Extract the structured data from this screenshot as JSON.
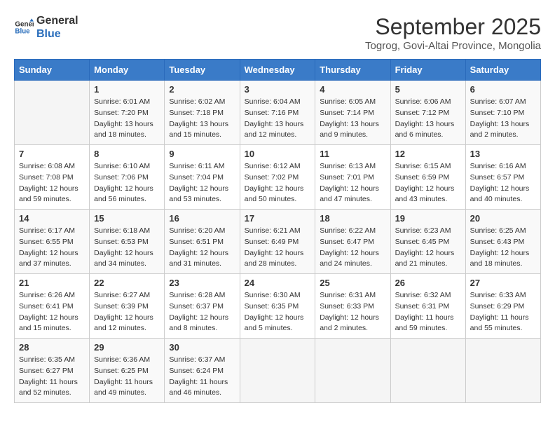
{
  "logo": {
    "line1": "General",
    "line2": "Blue"
  },
  "title": {
    "month_year": "September 2025",
    "location": "Togrog, Govi-Altai Province, Mongolia"
  },
  "calendar": {
    "days_of_week": [
      "Sunday",
      "Monday",
      "Tuesday",
      "Wednesday",
      "Thursday",
      "Friday",
      "Saturday"
    ],
    "weeks": [
      [
        {
          "day": "",
          "info": ""
        },
        {
          "day": "1",
          "info": "Sunrise: 6:01 AM\nSunset: 7:20 PM\nDaylight: 13 hours\nand 18 minutes."
        },
        {
          "day": "2",
          "info": "Sunrise: 6:02 AM\nSunset: 7:18 PM\nDaylight: 13 hours\nand 15 minutes."
        },
        {
          "day": "3",
          "info": "Sunrise: 6:04 AM\nSunset: 7:16 PM\nDaylight: 13 hours\nand 12 minutes."
        },
        {
          "day": "4",
          "info": "Sunrise: 6:05 AM\nSunset: 7:14 PM\nDaylight: 13 hours\nand 9 minutes."
        },
        {
          "day": "5",
          "info": "Sunrise: 6:06 AM\nSunset: 7:12 PM\nDaylight: 13 hours\nand 6 minutes."
        },
        {
          "day": "6",
          "info": "Sunrise: 6:07 AM\nSunset: 7:10 PM\nDaylight: 13 hours\nand 2 minutes."
        }
      ],
      [
        {
          "day": "7",
          "info": "Sunrise: 6:08 AM\nSunset: 7:08 PM\nDaylight: 12 hours\nand 59 minutes."
        },
        {
          "day": "8",
          "info": "Sunrise: 6:10 AM\nSunset: 7:06 PM\nDaylight: 12 hours\nand 56 minutes."
        },
        {
          "day": "9",
          "info": "Sunrise: 6:11 AM\nSunset: 7:04 PM\nDaylight: 12 hours\nand 53 minutes."
        },
        {
          "day": "10",
          "info": "Sunrise: 6:12 AM\nSunset: 7:02 PM\nDaylight: 12 hours\nand 50 minutes."
        },
        {
          "day": "11",
          "info": "Sunrise: 6:13 AM\nSunset: 7:01 PM\nDaylight: 12 hours\nand 47 minutes."
        },
        {
          "day": "12",
          "info": "Sunrise: 6:15 AM\nSunset: 6:59 PM\nDaylight: 12 hours\nand 43 minutes."
        },
        {
          "day": "13",
          "info": "Sunrise: 6:16 AM\nSunset: 6:57 PM\nDaylight: 12 hours\nand 40 minutes."
        }
      ],
      [
        {
          "day": "14",
          "info": "Sunrise: 6:17 AM\nSunset: 6:55 PM\nDaylight: 12 hours\nand 37 minutes."
        },
        {
          "day": "15",
          "info": "Sunrise: 6:18 AM\nSunset: 6:53 PM\nDaylight: 12 hours\nand 34 minutes."
        },
        {
          "day": "16",
          "info": "Sunrise: 6:20 AM\nSunset: 6:51 PM\nDaylight: 12 hours\nand 31 minutes."
        },
        {
          "day": "17",
          "info": "Sunrise: 6:21 AM\nSunset: 6:49 PM\nDaylight: 12 hours\nand 28 minutes."
        },
        {
          "day": "18",
          "info": "Sunrise: 6:22 AM\nSunset: 6:47 PM\nDaylight: 12 hours\nand 24 minutes."
        },
        {
          "day": "19",
          "info": "Sunrise: 6:23 AM\nSunset: 6:45 PM\nDaylight: 12 hours\nand 21 minutes."
        },
        {
          "day": "20",
          "info": "Sunrise: 6:25 AM\nSunset: 6:43 PM\nDaylight: 12 hours\nand 18 minutes."
        }
      ],
      [
        {
          "day": "21",
          "info": "Sunrise: 6:26 AM\nSunset: 6:41 PM\nDaylight: 12 hours\nand 15 minutes."
        },
        {
          "day": "22",
          "info": "Sunrise: 6:27 AM\nSunset: 6:39 PM\nDaylight: 12 hours\nand 12 minutes."
        },
        {
          "day": "23",
          "info": "Sunrise: 6:28 AM\nSunset: 6:37 PM\nDaylight: 12 hours\nand 8 minutes."
        },
        {
          "day": "24",
          "info": "Sunrise: 6:30 AM\nSunset: 6:35 PM\nDaylight: 12 hours\nand 5 minutes."
        },
        {
          "day": "25",
          "info": "Sunrise: 6:31 AM\nSunset: 6:33 PM\nDaylight: 12 hours\nand 2 minutes."
        },
        {
          "day": "26",
          "info": "Sunrise: 6:32 AM\nSunset: 6:31 PM\nDaylight: 11 hours\nand 59 minutes."
        },
        {
          "day": "27",
          "info": "Sunrise: 6:33 AM\nSunset: 6:29 PM\nDaylight: 11 hours\nand 55 minutes."
        }
      ],
      [
        {
          "day": "28",
          "info": "Sunrise: 6:35 AM\nSunset: 6:27 PM\nDaylight: 11 hours\nand 52 minutes."
        },
        {
          "day": "29",
          "info": "Sunrise: 6:36 AM\nSunset: 6:25 PM\nDaylight: 11 hours\nand 49 minutes."
        },
        {
          "day": "30",
          "info": "Sunrise: 6:37 AM\nSunset: 6:24 PM\nDaylight: 11 hours\nand 46 minutes."
        },
        {
          "day": "",
          "info": ""
        },
        {
          "day": "",
          "info": ""
        },
        {
          "day": "",
          "info": ""
        },
        {
          "day": "",
          "info": ""
        }
      ]
    ]
  }
}
